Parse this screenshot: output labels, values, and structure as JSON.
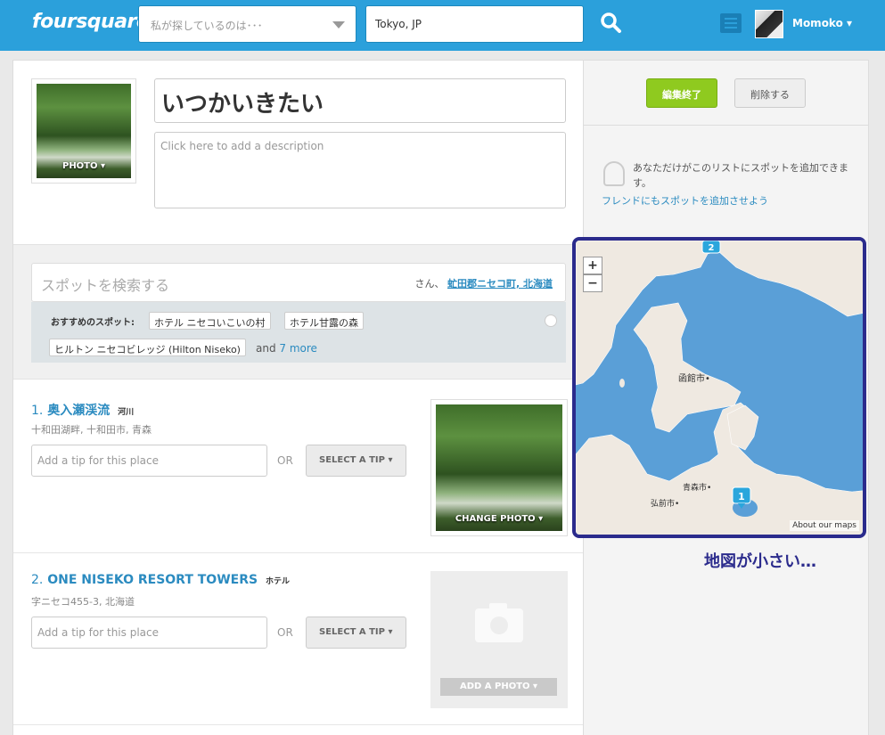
{
  "header": {
    "logo": "foursquare",
    "what_placeholder": "私が探しているのは･･･",
    "where_value": "Tokyo, JP",
    "username": "Momoko ▾"
  },
  "list": {
    "title": "いつかいきたい",
    "description_placeholder": "Click here to add a description",
    "photo_label": "PHOTO ▾"
  },
  "spot_search": {
    "placeholder": "スポットを検索する",
    "near_prefix": "さん、",
    "near_location": "虻田郡ニセコ町, 北海道",
    "recommended_label": "おすすめのスポット:",
    "recommended": [
      "ホテル ニセコいこいの村",
      "ホテル甘露の森",
      "ヒルトン ニセコビレッジ (Hilton Niseko)"
    ],
    "more_prefix": "and ",
    "more_link": "7 more"
  },
  "items": [
    {
      "num": "1.",
      "name": "奥入瀬渓流",
      "category": "河川",
      "address": "十和田湖畔, 十和田市, 青森",
      "tip_placeholder": "Add a tip for this place",
      "or": "OR",
      "select_tip": "SELECT A TIP ▾",
      "photo_button": "CHANGE PHOTO ▾"
    },
    {
      "num": "2.",
      "name": "ONE NISEKO RESORT TOWERS",
      "category": "ホテル",
      "address": "字ニセコ455-3, 北海道",
      "tip_placeholder": "Add a tip for this place",
      "or": "OR",
      "select_tip": "SELECT A TIP ▾",
      "photo_button": "ADD A PHOTO ▾"
    }
  ],
  "sidebar": {
    "done_button": "編集終了",
    "delete_button": "削除する",
    "only_you_text": "あなただけがこのリストにスポットを追加できます。",
    "invite_link": "フレンドにもスポットを追加させよう"
  },
  "map": {
    "zoom_in": "+",
    "zoom_out": "−",
    "label_hakodate": "函館市•",
    "label_aomori": "青森市•",
    "label_hirosaki": "弘前市•",
    "marker_1": "1",
    "marker_2": "2",
    "credit": "About our maps",
    "annotation": "地図が小さい…",
    "water_color": "#5a9fd7",
    "land_color": "#efe9e1"
  }
}
